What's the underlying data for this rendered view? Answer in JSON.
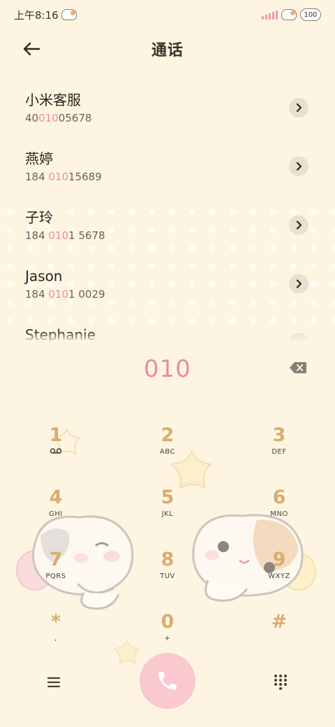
{
  "status": {
    "time": "上午8:16",
    "battery": "100"
  },
  "header": {
    "title": "通话"
  },
  "contacts": [
    {
      "name": "小米客服",
      "number_pre": "40",
      "number_hl": "010",
      "number_post": "05678"
    },
    {
      "name": "燕婷",
      "number_pre": "184 ",
      "number_hl": "010",
      "number_post": "15689"
    },
    {
      "name": "子玲",
      "number_pre": "184 ",
      "number_hl": "010",
      "number_post": "1 5678"
    },
    {
      "name": "Jason",
      "number_pre": "184 ",
      "number_hl": "010",
      "number_post": "1 0029"
    },
    {
      "name": "Stephanie",
      "number_pre": "",
      "number_hl": "",
      "number_post": ""
    }
  ],
  "dial": {
    "number": "010"
  },
  "keys": [
    {
      "digit": "1",
      "letters": ""
    },
    {
      "digit": "2",
      "letters": "ABC"
    },
    {
      "digit": "3",
      "letters": "DEF"
    },
    {
      "digit": "4",
      "letters": "GHI"
    },
    {
      "digit": "5",
      "letters": "JKL"
    },
    {
      "digit": "6",
      "letters": "MNO"
    },
    {
      "digit": "7",
      "letters": "PQRS"
    },
    {
      "digit": "8",
      "letters": "TUV"
    },
    {
      "digit": "9",
      "letters": "WXYZ"
    },
    {
      "digit": "*",
      "letters": ","
    },
    {
      "digit": "0",
      "letters": "+"
    },
    {
      "digit": "#",
      "letters": ""
    }
  ],
  "colors": {
    "background": "#fdf5e2",
    "accent": "#ef8a9a",
    "digit": "#d9ac70",
    "call_button": "#f9c9cf"
  },
  "icons": {
    "back": "arrow-left-icon",
    "row_arrow": "chevron-right-icon",
    "backspace": "backspace-icon",
    "voicemail": "voicemail-icon",
    "menu": "menu-icon",
    "call": "phone-icon",
    "dialpad": "dialpad-icon"
  }
}
